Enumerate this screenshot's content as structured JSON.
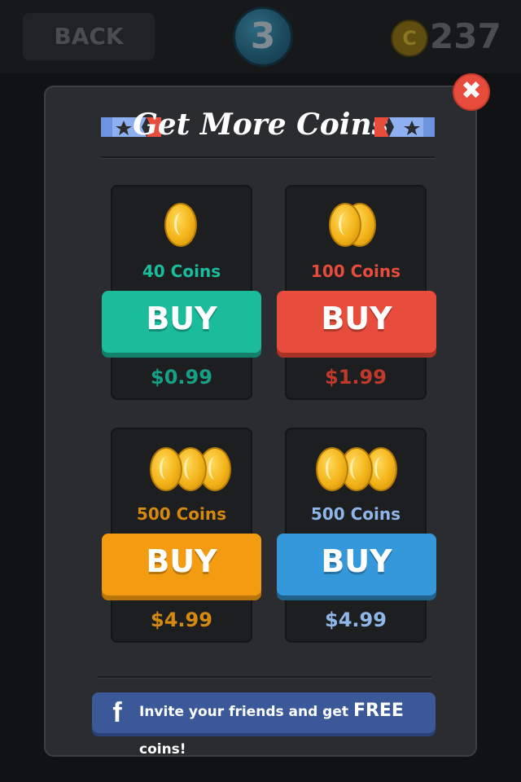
{
  "header": {
    "back_label": "BACK",
    "level": "3",
    "coin_symbol": "C",
    "coin_balance": "237"
  },
  "modal": {
    "title": "Get More Coins",
    "close_symbol": "✖",
    "packs": [
      {
        "label": "40 Coins",
        "button": "BUY",
        "price": "$0.99",
        "color": "#1abc9c",
        "price_color": "#16a085"
      },
      {
        "label": "100 Coins",
        "button": "BUY",
        "price": "$1.99",
        "color": "#e74c3c",
        "price_color": "#c0392b"
      },
      {
        "label": "500 Coins",
        "button": "BUY",
        "price": "$4.99",
        "color": "#f39c12",
        "price_color": "#d68910"
      },
      {
        "label": "500 Coins",
        "button": "BUY",
        "price": "$4.99",
        "color": "#3498db",
        "price_color": "#8fb6e8"
      }
    ],
    "facebook": {
      "icon": "f",
      "text_before": "Invite your friends and get ",
      "text_highlight": "FREE",
      "text_after": " coins!"
    }
  }
}
